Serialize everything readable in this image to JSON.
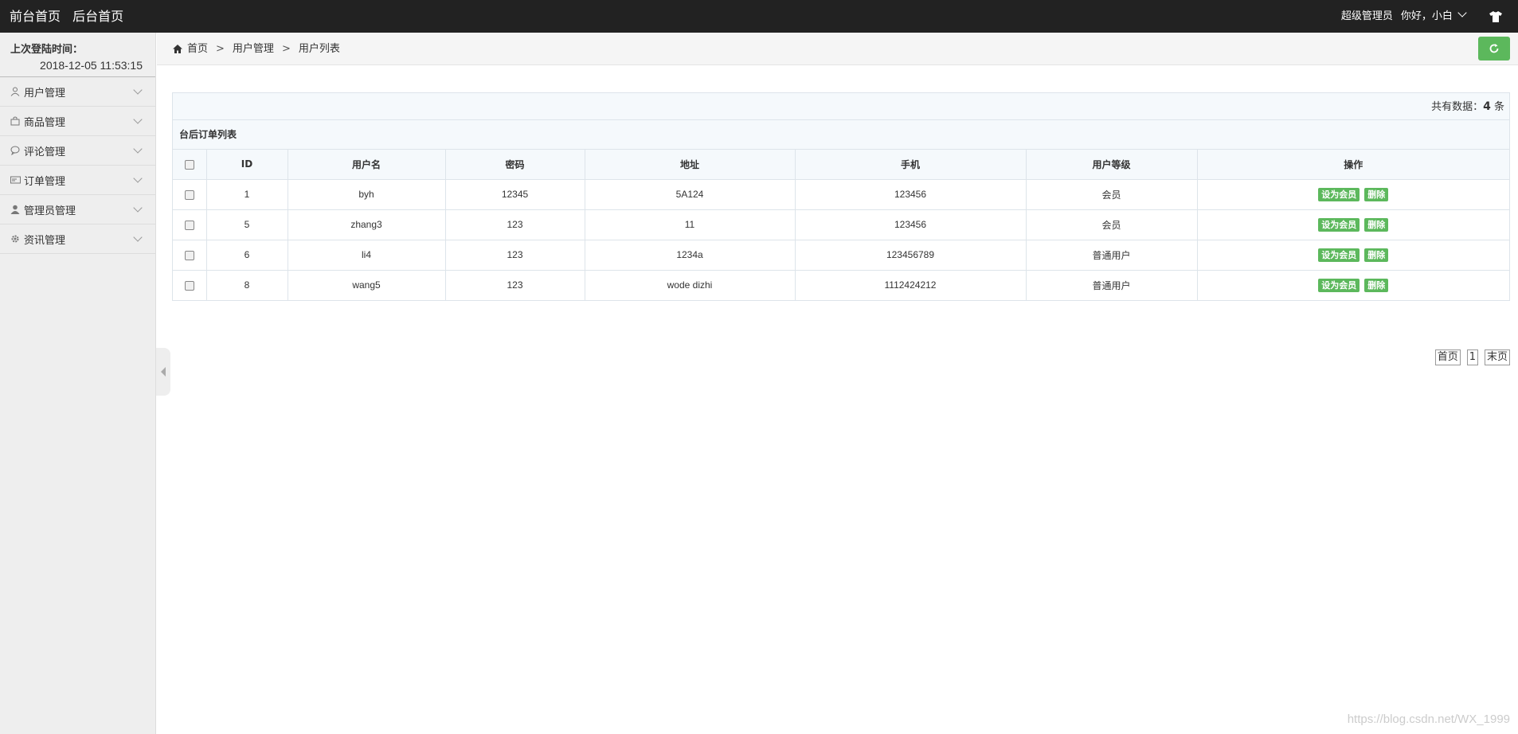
{
  "topbar": {
    "front_home": "前台首页",
    "admin_home": "后台首页",
    "role": "超级管理员",
    "greeting": "你好，小白",
    "shirt_icon": "tshirt-icon"
  },
  "sidebar": {
    "last_login_label": "上次登陆时间：",
    "last_login_time": "2018-12-05 11:53:15",
    "items": [
      {
        "label": "用户管理",
        "icon": "user-icon"
      },
      {
        "label": "商品管理",
        "icon": "bag-icon"
      },
      {
        "label": "评论管理",
        "icon": "comment-icon"
      },
      {
        "label": "订单管理",
        "icon": "order-icon"
      },
      {
        "label": "管理员管理",
        "icon": "person-icon"
      },
      {
        "label": "资讯管理",
        "icon": "gear-icon"
      }
    ]
  },
  "breadcrumb": {
    "home": "首页",
    "level1": "用户管理",
    "level2": "用户列表",
    "separator": ">"
  },
  "panel": {
    "count_prefix": "共有数据：",
    "count": "4",
    "count_suffix": "条",
    "title": "台后订单列表",
    "columns": [
      "ID",
      "用户名",
      "密码",
      "地址",
      "手机",
      "用户等级",
      "操作"
    ],
    "rows": [
      {
        "id": "1",
        "username": "byh",
        "password": "12345",
        "address": "5A124",
        "phone": "123456",
        "level": "会员"
      },
      {
        "id": "5",
        "username": "zhang3",
        "password": "123",
        "address": "11",
        "phone": "123456",
        "level": "会员"
      },
      {
        "id": "6",
        "username": "li4",
        "password": "123",
        "address": "1234a",
        "phone": "123456789",
        "level": "普通用户"
      },
      {
        "id": "8",
        "username": "wang5",
        "password": "123",
        "address": "wode dizhi",
        "phone": "1112424212",
        "level": "普通用户"
      }
    ],
    "action_set_member": "设为会员",
    "action_delete": "删除"
  },
  "pager": {
    "first": "首页",
    "page": "1",
    "last": "末页"
  },
  "watermark": "https://blog.csdn.net/WX_1999",
  "colors": {
    "topbar_bg": "#222222",
    "accent_green": "#5cb85c"
  }
}
